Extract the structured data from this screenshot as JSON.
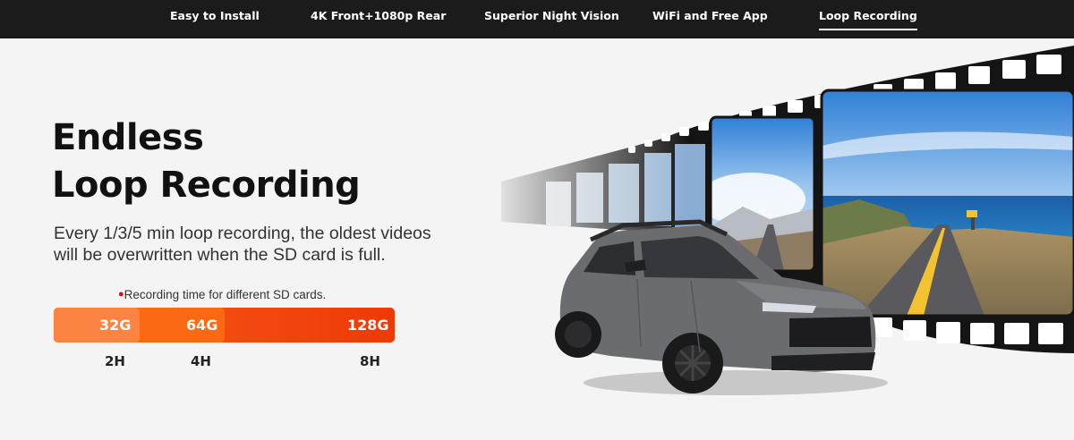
{
  "nav": {
    "items": [
      {
        "label": "Easy to Install",
        "active": false
      },
      {
        "label": "4K Front+1080p Rear",
        "active": false
      },
      {
        "label": "Superior Night Vision",
        "active": false
      },
      {
        "label": "WiFi and Free App",
        "active": false
      },
      {
        "label": "Loop Recording",
        "active": true
      }
    ]
  },
  "hero": {
    "title_line1": "Endless",
    "title_line2": "Loop Recording",
    "description": "Every 1/3/5 min loop recording, the oldest videos will be overwritten when the SD card is full.",
    "note_bullet": "●",
    "note": "Recording time for different SD cards."
  },
  "sd_cards": [
    {
      "capacity": "32G",
      "time": "2H"
    },
    {
      "capacity": "64G",
      "time": "4H"
    },
    {
      "capacity": "128G",
      "time": "8H"
    }
  ],
  "colors": {
    "nav_bg": "#1b1b1b",
    "bar_32": "#fc8442",
    "bar_64": "#fb6a13",
    "bar_128": "#ee3a08",
    "bullet": "#e60012"
  },
  "illustration": {
    "film_strip": "film-strip-coastal-road-scenes",
    "vehicle": "grey-suv"
  }
}
